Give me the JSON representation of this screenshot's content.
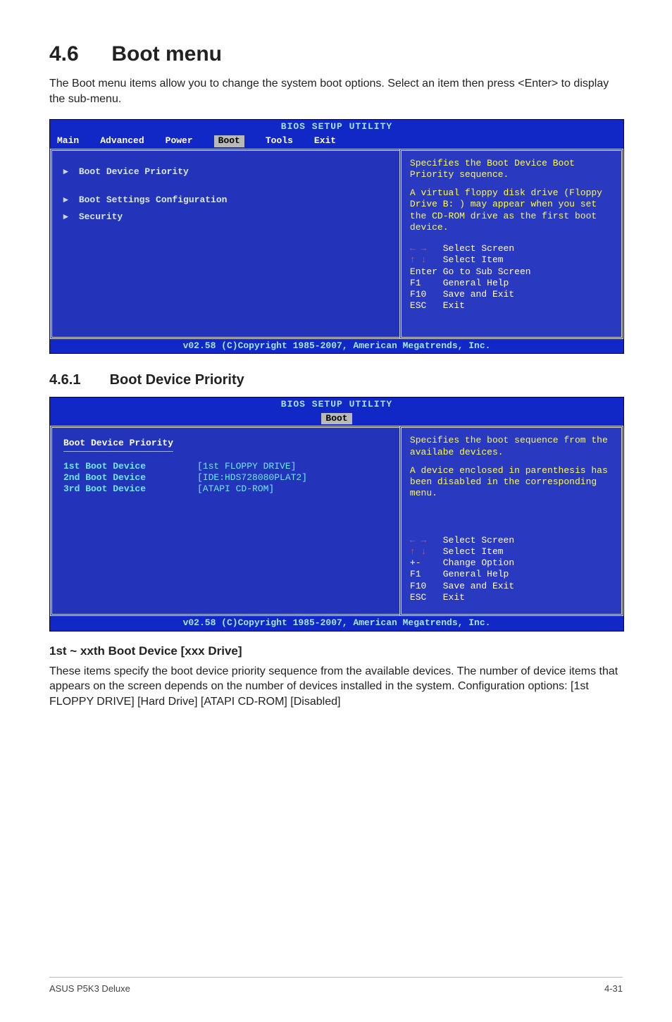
{
  "section": {
    "number": "4.6",
    "title": "Boot menu",
    "intro": "The Boot menu items allow you to change the system boot options. Select an item then press <Enter> to display the sub-menu."
  },
  "bios1": {
    "title": "BIOS SETUP UTILITY",
    "menubar": {
      "items": [
        "Main",
        "Advanced",
        "Power",
        "Boot",
        "Tools",
        "Exit"
      ],
      "selected_index": 3
    },
    "left_items": [
      {
        "marker": true,
        "label": "Boot Device Priority"
      },
      {
        "marker": true,
        "label": "Boot Settings Configuration"
      },
      {
        "marker": true,
        "label": "Security"
      }
    ],
    "right_help_top": "Specifies the Boot Device Boot Priority sequence.",
    "right_help_body": "A virtual floppy disk drive (Floppy Drive B: ) may appear when you set the CD-ROM drive as the first boot device.",
    "keys": {
      "arrows_lr": "Select Screen",
      "arrows_ud": "Select Item",
      "enter": "Go to Sub Screen",
      "f1": "General Help",
      "f10": "Save and Exit",
      "esc": "Exit"
    },
    "footer": "v02.58 (C)Copyright 1985-2007, American Megatrends, Inc."
  },
  "subsection": {
    "number": "4.6.1",
    "title": "Boot Device Priority"
  },
  "bios2": {
    "title": "BIOS SETUP UTILITY",
    "menubar_selected": "Boot",
    "heading": "Boot Device Priority",
    "rows": [
      {
        "label": "1st Boot Device",
        "value": "[1st FLOPPY DRIVE]"
      },
      {
        "label": "2nd Boot Device",
        "value": "[IDE:HDS728080PLAT2]"
      },
      {
        "label": "3rd Boot Device",
        "value": "[ATAPI CD-ROM]"
      }
    ],
    "right_help_top": "Specifies the boot sequence from the availabe devices.",
    "right_help_body": "A device enclosed in parenthesis has been disabled in the corresponding menu.",
    "keys": {
      "arrows_lr": "Select Screen",
      "arrows_ud": "Select Item",
      "plusminus": "Change Option",
      "f1": "General Help",
      "f10": "Save and Exit",
      "esc": "Exit"
    },
    "footer": "v02.58 (C)Copyright 1985-2007, American Megatrends, Inc."
  },
  "option": {
    "heading": "1st ~ xxth Boot Device [xxx Drive]",
    "body": "These items specify the boot device priority sequence from the available devices. The number of device items that appears on the screen depends on the number of devices installed in the system. Configuration options: [1st FLOPPY DRIVE] [Hard Drive] [ATAPI CD-ROM] [Disabled]"
  },
  "page_footer": {
    "left": "ASUS P5K3 Deluxe",
    "right": "4-31"
  }
}
